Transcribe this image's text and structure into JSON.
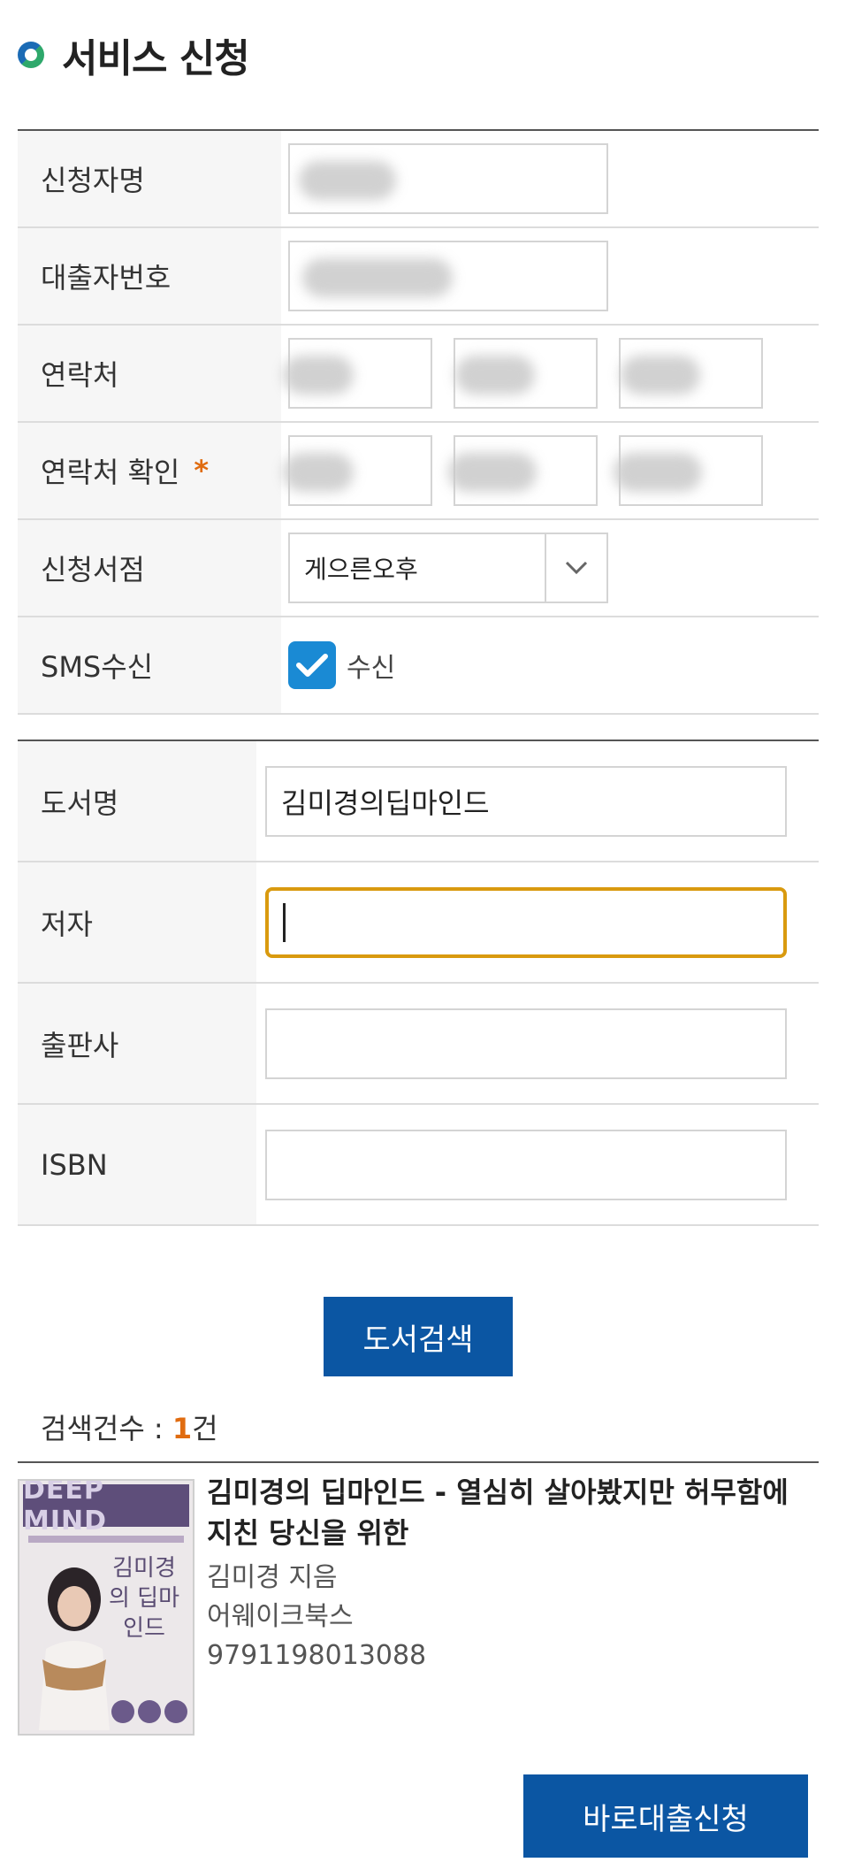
{
  "page": {
    "title": "서비스 신청"
  },
  "applicant_form": {
    "name_label": "신청자명",
    "card_label": "대출자번호",
    "contact_label": "연락처",
    "contact_confirm_label": "연락처 확인",
    "required_mark": "*",
    "store_label": "신청서점",
    "store_value": "게으른오후",
    "sms_label": "SMS수신",
    "sms_option": "수신",
    "sms_checked": true
  },
  "book_form": {
    "title_label": "도서명",
    "title_value": "김미경의딥마인드",
    "author_label": "저자",
    "author_value": "",
    "publisher_label": "출판사",
    "publisher_value": "",
    "isbn_label": "ISBN",
    "isbn_value": ""
  },
  "search_button": "도서검색",
  "results": {
    "count_prefix": "검색건수 : ",
    "count": "1",
    "count_suffix": "건",
    "items": [
      {
        "title": "김미경의 딥마인드 - 열심히 살아봤지만 허무함에 지친 당신을 위한",
        "author": "김미경 지음",
        "publisher": "어웨이크북스",
        "isbn": "9791198013088",
        "cover_text": "DEEP MIND",
        "cover_title": "김미경의 딥마인드"
      }
    ]
  },
  "apply_button": "바로대출신청",
  "colors": {
    "primary": "#0b56a3",
    "accent": "#e06c10",
    "focus": "#d99a0f",
    "check": "#1a8ad4"
  }
}
